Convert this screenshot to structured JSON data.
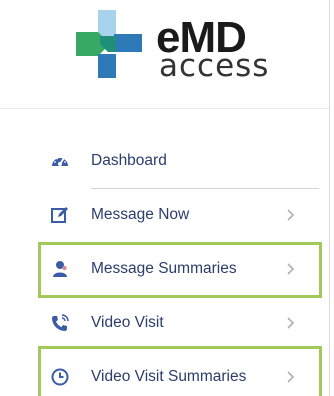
{
  "brand": {
    "name_main": "eMD",
    "name_sub": "access"
  },
  "colors": {
    "logo_green": "#37a964",
    "logo_blue": "#2e79b8",
    "logo_light_blue": "#a8d3ec",
    "nav_text": "#2b3d6b",
    "icon_blue": "#3b5ca8",
    "highlight_border": "#a3c95a"
  },
  "nav": {
    "items": [
      {
        "label": "Dashboard",
        "icon": "dashboard-gauge-icon",
        "has_chevron": false,
        "highlighted": false
      },
      {
        "label": "Message Now",
        "icon": "edit-message-icon",
        "has_chevron": true,
        "highlighted": false
      },
      {
        "label": "Message Summaries",
        "icon": "user-summary-icon",
        "has_chevron": true,
        "highlighted": true
      },
      {
        "label": "Video Visit",
        "icon": "phone-call-icon",
        "has_chevron": true,
        "highlighted": false
      },
      {
        "label": "Video Visit Summaries",
        "icon": "clock-icon",
        "has_chevron": true,
        "highlighted": true
      }
    ]
  }
}
